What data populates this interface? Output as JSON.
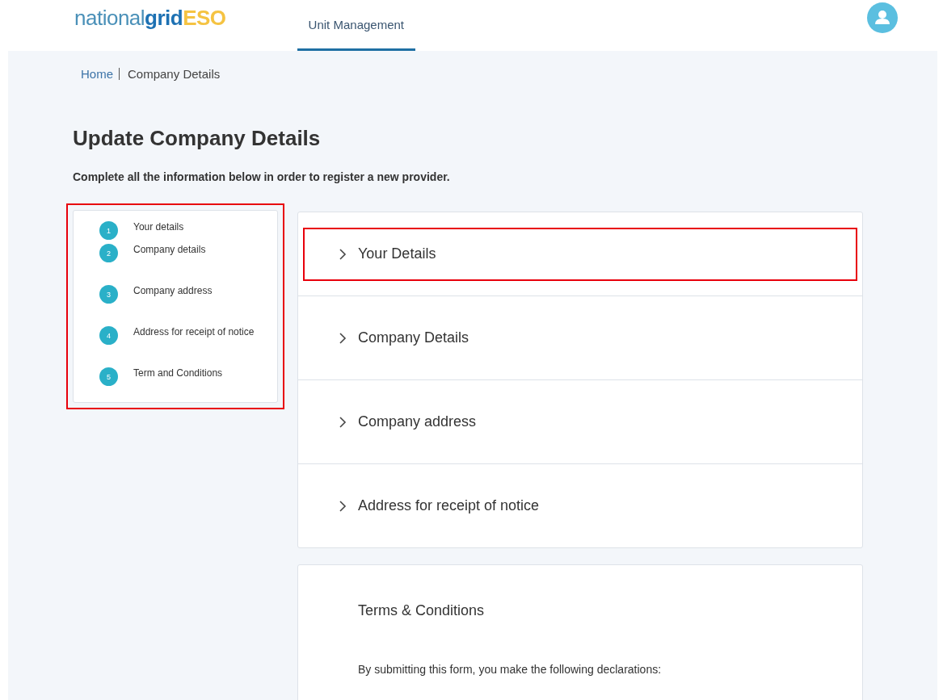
{
  "header": {
    "logo": [
      "national",
      "grid",
      "ESO"
    ],
    "nav": [
      {
        "label": "Unit Management",
        "selected": true
      }
    ]
  },
  "breadcrumb": [
    {
      "label": "Home",
      "kind": "link"
    },
    {
      "label": "Company Details",
      "kind": "current"
    }
  ],
  "title": "Update Company Details",
  "subtitle": "Complete all the information below in order to register a new provider.",
  "steps": [
    {
      "number": "1",
      "label": "Your details"
    },
    {
      "number": "2",
      "label": "Company details"
    },
    {
      "number": "3",
      "label": "Company address"
    },
    {
      "number": "4",
      "label": "Address for receipt of notice"
    },
    {
      "number": "5",
      "label": "Term and Conditions"
    }
  ],
  "sections": [
    {
      "title": "Your Details",
      "expanded": false,
      "highlighted": true
    },
    {
      "title": "Company Details",
      "expanded": false,
      "highlighted": false
    },
    {
      "title": "Company address",
      "expanded": false,
      "highlighted": false
    },
    {
      "title": "Address for receipt of notice",
      "expanded": false,
      "highlighted": false
    }
  ],
  "terms": {
    "title": "Terms & Conditions",
    "text": "By submitting this form, you make the following declarations:"
  },
  "steps_highlighted": true
}
